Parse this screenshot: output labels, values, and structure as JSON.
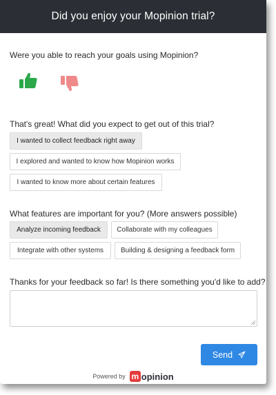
{
  "header": {
    "title": "Did you enjoy your Mopinion trial?"
  },
  "goals": {
    "question": "Were you able to reach your goals using Mopinion?",
    "thumbs_up_icon": "thumbs-up-icon",
    "thumbs_down_icon": "thumbs-down-icon",
    "up_color": "#2aa84a",
    "down_color": "#f08a8a"
  },
  "expectations": {
    "question": "That's great! What did you expect to get out of this trial?",
    "options": [
      {
        "label": "I wanted to collect feedback right away",
        "selected": true
      },
      {
        "label": "I explored and wanted to know how Mopinion works",
        "selected": false
      },
      {
        "label": "I wanted to know more about certain features",
        "selected": false
      }
    ]
  },
  "features": {
    "question": "What features are important for you? (More answers possible)",
    "options": [
      {
        "label": "Analyze incoming feedback",
        "selected": true
      },
      {
        "label": "Collaborate with my colleagues",
        "selected": false
      },
      {
        "label": "Integrate with other systems",
        "selected": false
      },
      {
        "label": "Building & designing a feedback form",
        "selected": false
      }
    ]
  },
  "comments": {
    "question": "Thanks for your feedback so far! Is there something you'd like to add?",
    "value": ""
  },
  "send": {
    "label": "Send",
    "icon": "paper-plane-icon",
    "color": "#2f88e3"
  },
  "footer": {
    "powered_by": "Powered by",
    "logo_mark": "m",
    "logo_text": "opinion"
  }
}
